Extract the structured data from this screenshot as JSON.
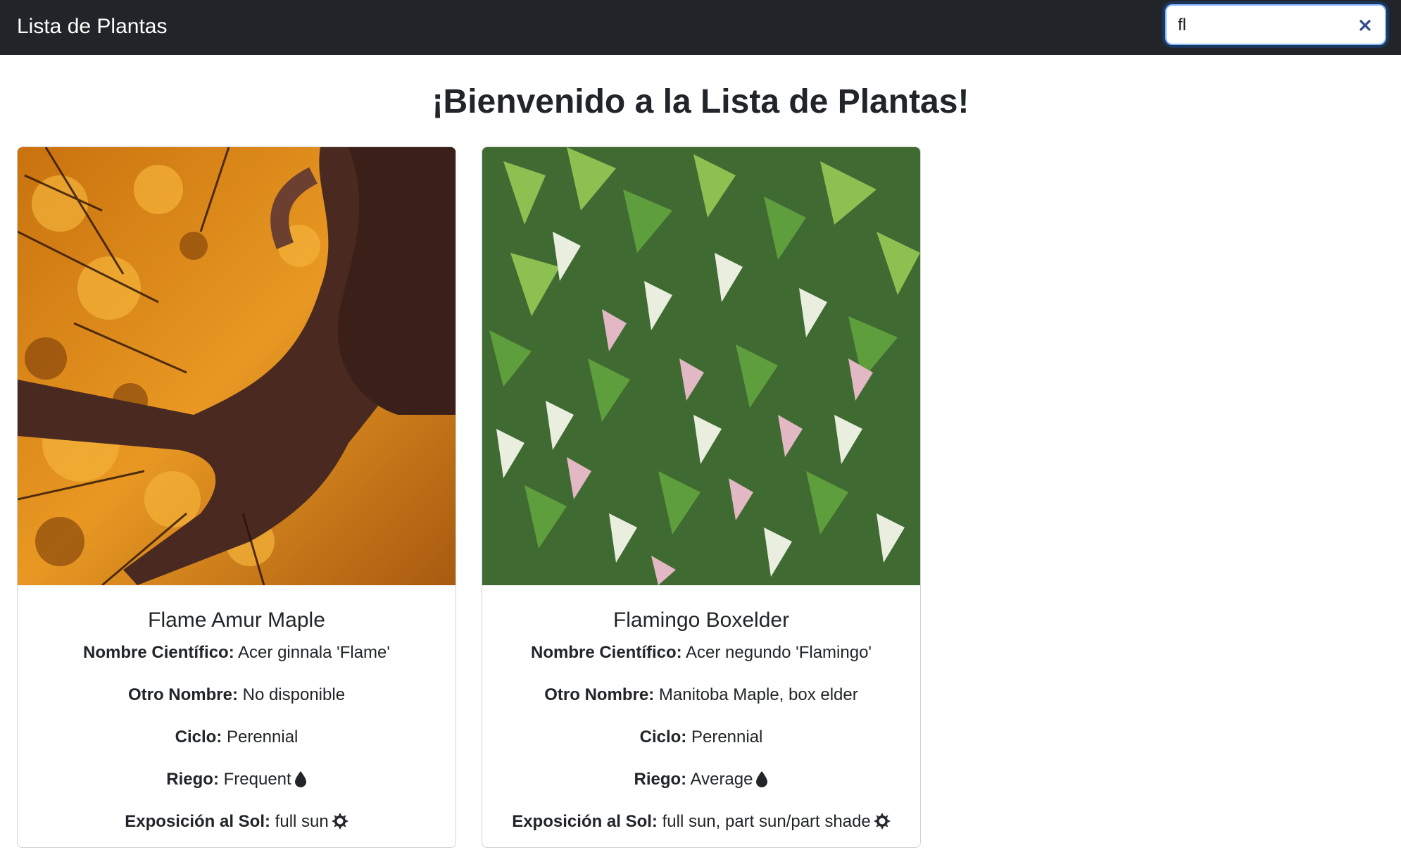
{
  "navbar": {
    "brand": "Lista de Plantas",
    "search": {
      "value": "fl",
      "placeholder": ""
    }
  },
  "page": {
    "title": "¡Bienvenido a la Lista de Plantas!"
  },
  "labels": {
    "scientific": "Nombre Científico:",
    "other": "Otro Nombre:",
    "cycle": "Ciclo:",
    "watering": "Riego:",
    "sun": "Exposición al Sol:"
  },
  "plants": [
    {
      "name": "Flame Amur Maple",
      "scientific_name": "Acer ginnala 'Flame'",
      "other_name": "No disponible",
      "cycle": "Perennial",
      "watering": "Frequent",
      "sunlight": "full sun",
      "image_icon": "autumn-maple-photo"
    },
    {
      "name": "Flamingo Boxelder",
      "scientific_name": "Acer negundo 'Flamingo'",
      "other_name": "Manitoba Maple, box elder",
      "cycle": "Perennial",
      "watering": "Average",
      "sunlight": "full sun, part sun/part shade",
      "image_icon": "variegated-boxelder-photo"
    }
  ],
  "icons": {
    "water": "droplet-icon",
    "sun": "sun-icon",
    "clear": "close-icon"
  },
  "colors": {
    "navbar": "#212529",
    "focus": "#86b7fe",
    "clear": "#2c4a8c"
  }
}
